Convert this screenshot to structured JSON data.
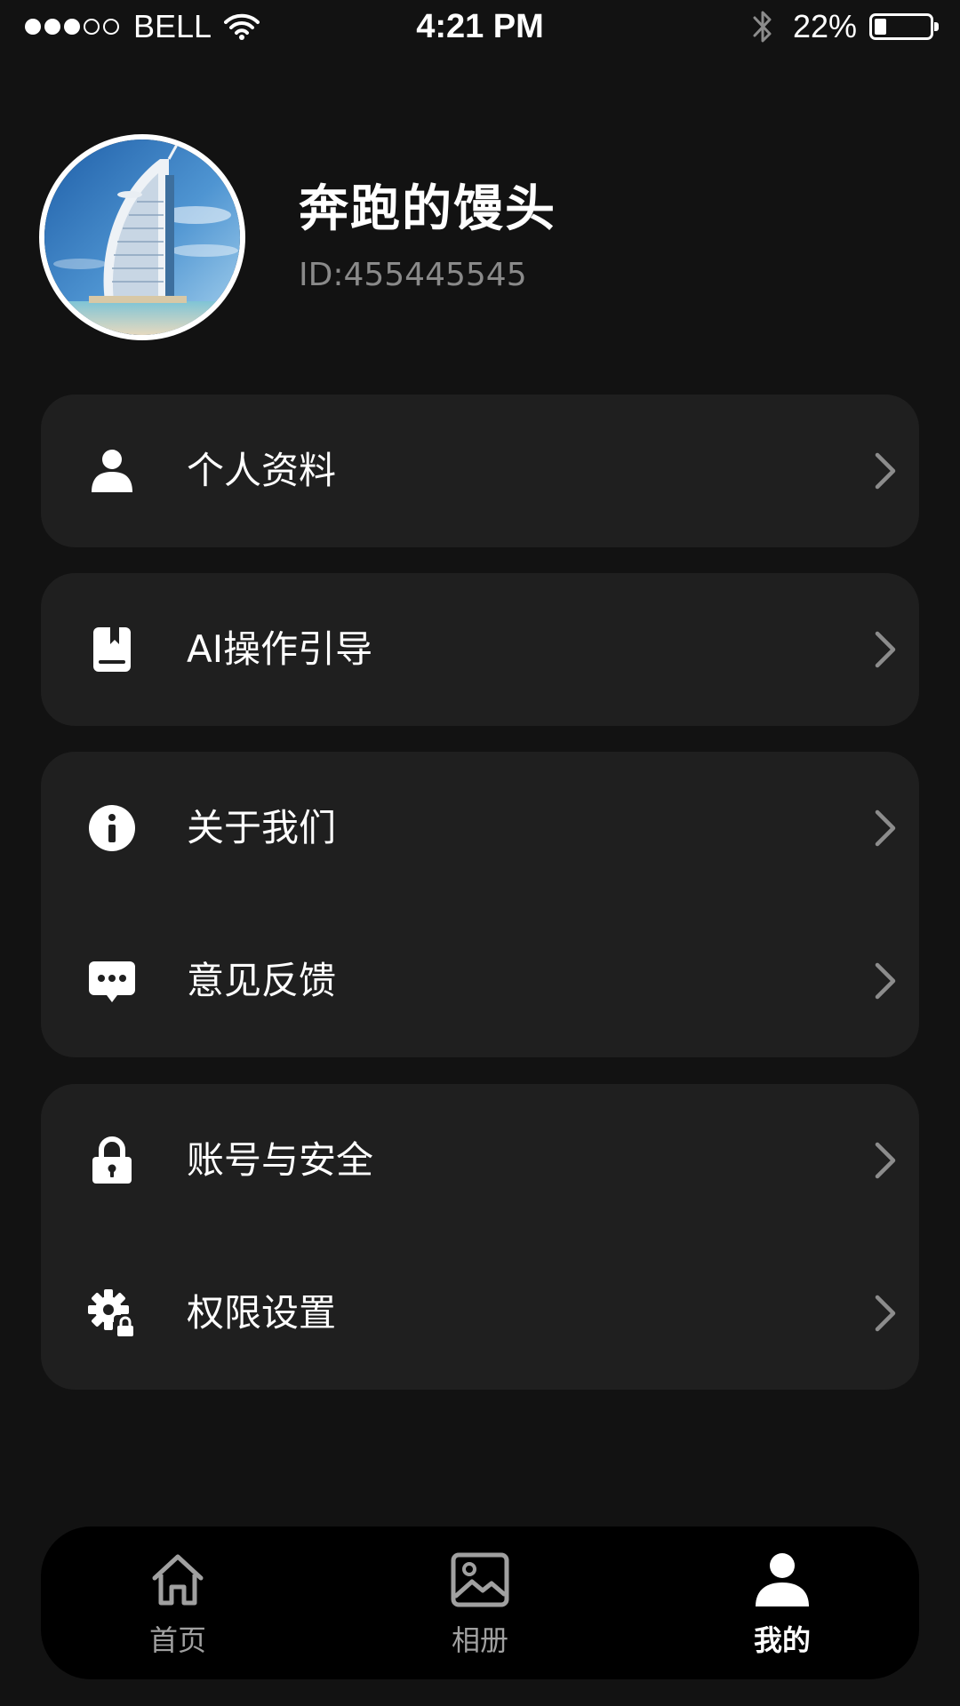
{
  "status_bar": {
    "carrier": "BELL",
    "signal_bars_filled": 3,
    "signal_bars_total": 5,
    "time": "4:21 PM",
    "battery_percent_text": "22%",
    "battery_level": 0.22,
    "icons": [
      "signal-dots-icon",
      "wifi-icon",
      "bluetooth-icon",
      "battery-icon"
    ]
  },
  "profile": {
    "name": "奔跑的馒头",
    "id_text": "ID:455445545",
    "avatar_icon": "avatar-photo-burj-al-arab"
  },
  "menu_groups": [
    {
      "items": [
        {
          "label": "个人资料",
          "icon": "person-icon"
        }
      ]
    },
    {
      "items": [
        {
          "label": "AI操作引导",
          "icon": "book-icon"
        }
      ]
    },
    {
      "items": [
        {
          "label": "关于我们",
          "icon": "info-icon"
        },
        {
          "label": "意见反馈",
          "icon": "chat-bubble-icon"
        }
      ]
    },
    {
      "items": [
        {
          "label": "账号与安全",
          "icon": "lock-icon"
        },
        {
          "label": "权限设置",
          "icon": "gear-lock-icon"
        }
      ]
    }
  ],
  "tabbar": {
    "active_index": 2,
    "tabs": [
      {
        "label": "首页",
        "icon": "home-icon"
      },
      {
        "label": "相册",
        "icon": "image-icon"
      },
      {
        "label": "我的",
        "icon": "person-icon"
      }
    ]
  },
  "colors": {
    "background": "#121212",
    "card": "#1f1f1f",
    "tabbar": "#000000",
    "text_primary": "#ffffff",
    "text_secondary": "#8a8a8a",
    "chevron": "#8c8c8c",
    "tab_inactive": "#a0a0a0"
  }
}
